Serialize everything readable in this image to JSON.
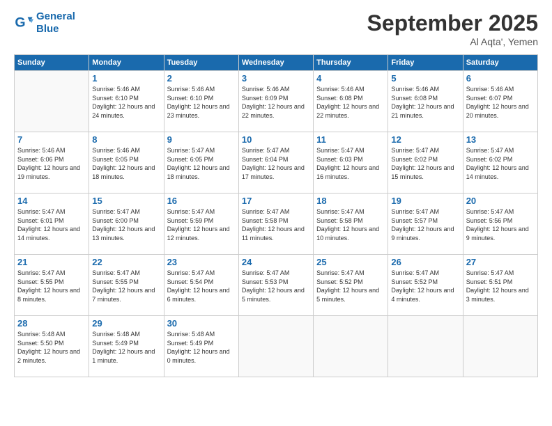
{
  "logo": {
    "line1": "General",
    "line2": "Blue"
  },
  "title": "September 2025",
  "location": "Al Aqta', Yemen",
  "days_of_week": [
    "Sunday",
    "Monday",
    "Tuesday",
    "Wednesday",
    "Thursday",
    "Friday",
    "Saturday"
  ],
  "weeks": [
    [
      {
        "day": null
      },
      {
        "day": 1,
        "sunrise": "Sunrise: 5:46 AM",
        "sunset": "Sunset: 6:10 PM",
        "daylight": "Daylight: 12 hours and 24 minutes."
      },
      {
        "day": 2,
        "sunrise": "Sunrise: 5:46 AM",
        "sunset": "Sunset: 6:10 PM",
        "daylight": "Daylight: 12 hours and 23 minutes."
      },
      {
        "day": 3,
        "sunrise": "Sunrise: 5:46 AM",
        "sunset": "Sunset: 6:09 PM",
        "daylight": "Daylight: 12 hours and 22 minutes."
      },
      {
        "day": 4,
        "sunrise": "Sunrise: 5:46 AM",
        "sunset": "Sunset: 6:08 PM",
        "daylight": "Daylight: 12 hours and 22 minutes."
      },
      {
        "day": 5,
        "sunrise": "Sunrise: 5:46 AM",
        "sunset": "Sunset: 6:08 PM",
        "daylight": "Daylight: 12 hours and 21 minutes."
      },
      {
        "day": 6,
        "sunrise": "Sunrise: 5:46 AM",
        "sunset": "Sunset: 6:07 PM",
        "daylight": "Daylight: 12 hours and 20 minutes."
      }
    ],
    [
      {
        "day": 7,
        "sunrise": "Sunrise: 5:46 AM",
        "sunset": "Sunset: 6:06 PM",
        "daylight": "Daylight: 12 hours and 19 minutes."
      },
      {
        "day": 8,
        "sunrise": "Sunrise: 5:46 AM",
        "sunset": "Sunset: 6:05 PM",
        "daylight": "Daylight: 12 hours and 18 minutes."
      },
      {
        "day": 9,
        "sunrise": "Sunrise: 5:47 AM",
        "sunset": "Sunset: 6:05 PM",
        "daylight": "Daylight: 12 hours and 18 minutes."
      },
      {
        "day": 10,
        "sunrise": "Sunrise: 5:47 AM",
        "sunset": "Sunset: 6:04 PM",
        "daylight": "Daylight: 12 hours and 17 minutes."
      },
      {
        "day": 11,
        "sunrise": "Sunrise: 5:47 AM",
        "sunset": "Sunset: 6:03 PM",
        "daylight": "Daylight: 12 hours and 16 minutes."
      },
      {
        "day": 12,
        "sunrise": "Sunrise: 5:47 AM",
        "sunset": "Sunset: 6:02 PM",
        "daylight": "Daylight: 12 hours and 15 minutes."
      },
      {
        "day": 13,
        "sunrise": "Sunrise: 5:47 AM",
        "sunset": "Sunset: 6:02 PM",
        "daylight": "Daylight: 12 hours and 14 minutes."
      }
    ],
    [
      {
        "day": 14,
        "sunrise": "Sunrise: 5:47 AM",
        "sunset": "Sunset: 6:01 PM",
        "daylight": "Daylight: 12 hours and 14 minutes."
      },
      {
        "day": 15,
        "sunrise": "Sunrise: 5:47 AM",
        "sunset": "Sunset: 6:00 PM",
        "daylight": "Daylight: 12 hours and 13 minutes."
      },
      {
        "day": 16,
        "sunrise": "Sunrise: 5:47 AM",
        "sunset": "Sunset: 5:59 PM",
        "daylight": "Daylight: 12 hours and 12 minutes."
      },
      {
        "day": 17,
        "sunrise": "Sunrise: 5:47 AM",
        "sunset": "Sunset: 5:58 PM",
        "daylight": "Daylight: 12 hours and 11 minutes."
      },
      {
        "day": 18,
        "sunrise": "Sunrise: 5:47 AM",
        "sunset": "Sunset: 5:58 PM",
        "daylight": "Daylight: 12 hours and 10 minutes."
      },
      {
        "day": 19,
        "sunrise": "Sunrise: 5:47 AM",
        "sunset": "Sunset: 5:57 PM",
        "daylight": "Daylight: 12 hours and 9 minutes."
      },
      {
        "day": 20,
        "sunrise": "Sunrise: 5:47 AM",
        "sunset": "Sunset: 5:56 PM",
        "daylight": "Daylight: 12 hours and 9 minutes."
      }
    ],
    [
      {
        "day": 21,
        "sunrise": "Sunrise: 5:47 AM",
        "sunset": "Sunset: 5:55 PM",
        "daylight": "Daylight: 12 hours and 8 minutes."
      },
      {
        "day": 22,
        "sunrise": "Sunrise: 5:47 AM",
        "sunset": "Sunset: 5:55 PM",
        "daylight": "Daylight: 12 hours and 7 minutes."
      },
      {
        "day": 23,
        "sunrise": "Sunrise: 5:47 AM",
        "sunset": "Sunset: 5:54 PM",
        "daylight": "Daylight: 12 hours and 6 minutes."
      },
      {
        "day": 24,
        "sunrise": "Sunrise: 5:47 AM",
        "sunset": "Sunset: 5:53 PM",
        "daylight": "Daylight: 12 hours and 5 minutes."
      },
      {
        "day": 25,
        "sunrise": "Sunrise: 5:47 AM",
        "sunset": "Sunset: 5:52 PM",
        "daylight": "Daylight: 12 hours and 5 minutes."
      },
      {
        "day": 26,
        "sunrise": "Sunrise: 5:47 AM",
        "sunset": "Sunset: 5:52 PM",
        "daylight": "Daylight: 12 hours and 4 minutes."
      },
      {
        "day": 27,
        "sunrise": "Sunrise: 5:47 AM",
        "sunset": "Sunset: 5:51 PM",
        "daylight": "Daylight: 12 hours and 3 minutes."
      }
    ],
    [
      {
        "day": 28,
        "sunrise": "Sunrise: 5:48 AM",
        "sunset": "Sunset: 5:50 PM",
        "daylight": "Daylight: 12 hours and 2 minutes."
      },
      {
        "day": 29,
        "sunrise": "Sunrise: 5:48 AM",
        "sunset": "Sunset: 5:49 PM",
        "daylight": "Daylight: 12 hours and 1 minute."
      },
      {
        "day": 30,
        "sunrise": "Sunrise: 5:48 AM",
        "sunset": "Sunset: 5:49 PM",
        "daylight": "Daylight: 12 hours and 0 minutes."
      },
      {
        "day": null
      },
      {
        "day": null
      },
      {
        "day": null
      },
      {
        "day": null
      }
    ]
  ]
}
